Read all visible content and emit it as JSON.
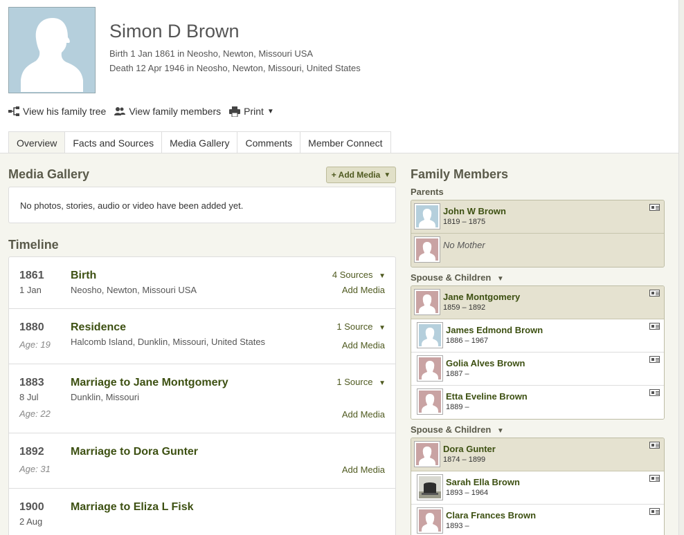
{
  "person": {
    "name": "Simon D Brown",
    "birth": "Birth 1 Jan 1861 in Neosho, Newton, Missouri USA",
    "death": "Death 12 Apr 1946 in Neosho, Newton, Missouri, United States"
  },
  "actions": {
    "family_tree": "View his family tree",
    "family_members": "View family members",
    "print": "Print"
  },
  "tabs": [
    "Overview",
    "Facts and Sources",
    "Media Gallery",
    "Comments",
    "Member Connect"
  ],
  "media": {
    "title": "Media Gallery",
    "add_button": "+ Add Media",
    "empty": "No photos, stories, audio or video have been added yet."
  },
  "timeline": {
    "title": "Timeline",
    "events": [
      {
        "year": "1861",
        "date": "1 Jan",
        "age": "",
        "title": "Birth",
        "place": "Neosho, Newton, Missouri USA",
        "sources": "4 Sources",
        "add_media": "Add Media"
      },
      {
        "year": "1880",
        "date": "",
        "age": "Age: 19",
        "title": "Residence",
        "place": "Halcomb Island, Dunklin, Missouri, United States",
        "sources": "1 Source",
        "add_media": "Add Media"
      },
      {
        "year": "1883",
        "date": "8 Jul",
        "age": "Age: 22",
        "title": "Marriage to Jane Montgomery",
        "place": "Dunklin, Missouri",
        "sources": "1 Source",
        "add_media": "Add Media"
      },
      {
        "year": "1892",
        "date": "",
        "age": "Age: 31",
        "title": "Marriage to Dora Gunter",
        "place": "",
        "sources": "",
        "add_media": "Add Media"
      },
      {
        "year": "1900",
        "date": "2 Aug",
        "age": "",
        "title": "Marriage to Eliza L Fisk",
        "place": "",
        "sources": "",
        "add_media": ""
      }
    ]
  },
  "family": {
    "title": "Family Members",
    "parents_label": "Parents",
    "spouse_label": "Spouse & Children",
    "parents": [
      {
        "name": "John W Brown",
        "dates": "1819 – 1875",
        "gender": "male"
      },
      {
        "name": "No Mother",
        "dates": "",
        "gender": "female"
      }
    ],
    "spouse1": {
      "name": "Jane Montgomery",
      "dates": "1859 – 1892",
      "gender": "female"
    },
    "children1": [
      {
        "name": "James Edmond Brown",
        "dates": "1886 – 1967",
        "gender": "male"
      },
      {
        "name": "Golia Alves Brown",
        "dates": "1887 –",
        "gender": "female"
      },
      {
        "name": "Etta Eveline Brown",
        "dates": "1889 –",
        "gender": "female"
      }
    ],
    "spouse2": {
      "name": "Dora Gunter",
      "dates": "1874 – 1899",
      "gender": "female"
    },
    "children2": [
      {
        "name": "Sarah Ella Brown",
        "dates": "1893 – 1964",
        "gender": "photo"
      },
      {
        "name": "Clara Frances Brown",
        "dates": "1893 –",
        "gender": "female"
      }
    ]
  },
  "colors": {
    "male_silhouette_bg": "#b5cfdc",
    "female_silhouette_bg": "#c9a3a3",
    "link": "#3d5012",
    "panel_bg": "#f5f5ee"
  }
}
